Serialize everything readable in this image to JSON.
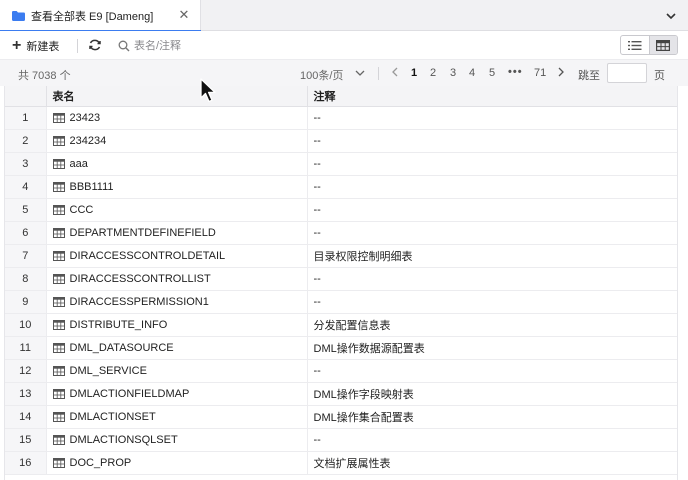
{
  "tab": {
    "title": "查看全部表 E9 [Dameng]",
    "close_glyph": "✕",
    "icon": "folder-icon",
    "accent_color": "#3b7cf0"
  },
  "toolbar": {
    "new_label": "新建表",
    "search_placeholder": "表名/注释"
  },
  "pagination": {
    "total": "共 7038 个",
    "page_size": "100条/页",
    "pages": [
      "1",
      "2",
      "3",
      "4",
      "5"
    ],
    "current_page": "1",
    "ellipsis": "•••",
    "last_page": "71",
    "goto_label": "跳至",
    "goto_unit": "页",
    "goto_value": ""
  },
  "table": {
    "columns": [
      "表名",
      "注释"
    ],
    "rows": [
      {
        "idx": "1",
        "name": "23423",
        "comment": "--"
      },
      {
        "idx": "2",
        "name": "234234",
        "comment": "--"
      },
      {
        "idx": "3",
        "name": "aaa",
        "comment": "--"
      },
      {
        "idx": "4",
        "name": "BBB1111",
        "comment": "--"
      },
      {
        "idx": "5",
        "name": "CCC",
        "comment": "--"
      },
      {
        "idx": "6",
        "name": "DEPARTMENTDEFINEFIELD",
        "comment": "--"
      },
      {
        "idx": "7",
        "name": "DIRACCESSCONTROLDETAIL",
        "comment": "目录权限控制明细表"
      },
      {
        "idx": "8",
        "name": "DIRACCESSCONTROLLIST",
        "comment": "--"
      },
      {
        "idx": "9",
        "name": "DIRACCESSPERMISSION1",
        "comment": "--"
      },
      {
        "idx": "10",
        "name": "DISTRIBUTE_INFO",
        "comment": "分发配置信息表"
      },
      {
        "idx": "11",
        "name": "DML_DATASOURCE",
        "comment": "DML操作数据源配置表"
      },
      {
        "idx": "12",
        "name": "DML_SERVICE",
        "comment": "--"
      },
      {
        "idx": "13",
        "name": "DMLACTIONFIELDMAP",
        "comment": "DML操作字段映射表"
      },
      {
        "idx": "14",
        "name": "DMLACTIONSET",
        "comment": "DML操作集合配置表"
      },
      {
        "idx": "15",
        "name": "DMLACTIONSQLSET",
        "comment": "--"
      },
      {
        "idx": "16",
        "name": "DOC_PROP",
        "comment": "文档扩展属性表"
      }
    ]
  }
}
